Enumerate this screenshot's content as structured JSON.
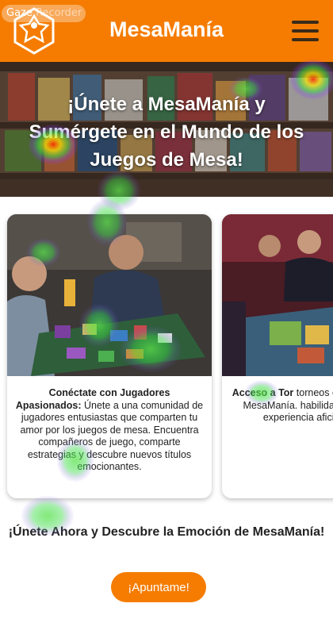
{
  "gaze_overlay": {
    "label": "Gaze",
    "label_dim": "Recorder"
  },
  "header": {
    "app_title": "MesaManía",
    "logo_icon": "meeple-logo-icon",
    "menu_icon": "hamburger-menu-icon"
  },
  "hero": {
    "title": "¡Únete a MesaManía y Sumérgete en el Mundo de los Juegos de Mesa!"
  },
  "cards": [
    {
      "title": "Conéctate con Jugadores Apasionados:",
      "body": "Únete a una comunidad de jugadores entusiastas que comparten tu amor por los juegos de mesa. Encuentra compañeros de juego, comparte estrategias y descubre nuevos títulos emocionantes."
    },
    {
      "title": "Acceso a Tor",
      "body": "torneos emoci especiales e MesaManía. habilidades, gana p una experiencia aficionados a lo"
    }
  ],
  "cta": {
    "title": "¡Únete Ahora y Descubre la Emoción de MesaManía!",
    "button_label": "¡Apuntame!"
  },
  "colors": {
    "brand": "#f57c00",
    "menu_bars": "#3a2a1a"
  }
}
